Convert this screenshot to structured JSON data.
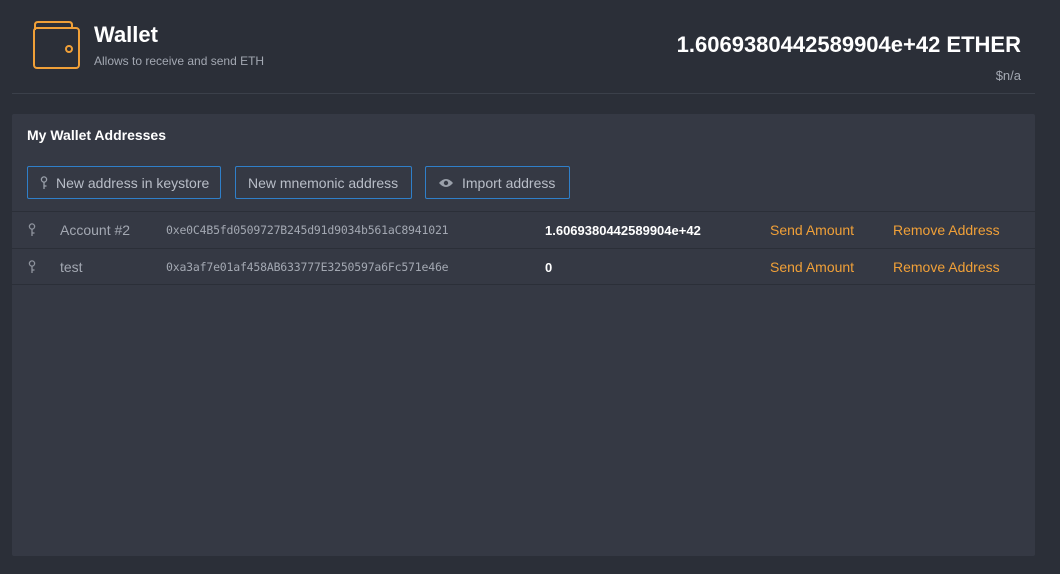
{
  "header": {
    "title": "Wallet",
    "subtitle": "Allows to receive and send ETH",
    "balance": "1.6069380442589904e+42 ETHER",
    "fiat": "$n/a",
    "icon": "wallet-icon",
    "accent_color": "#f0a038"
  },
  "panel": {
    "title": "My Wallet Addresses",
    "buttons": [
      {
        "label": "New address in keystore",
        "icon": "key-icon"
      },
      {
        "label": "New mnemonic address",
        "icon": ""
      },
      {
        "label": "Import address",
        "icon": "eye-icon"
      }
    ],
    "accounts": [
      {
        "name": "Account #2",
        "address": "0xe0C4B5fd0509727B245d91d9034b561aC8941021",
        "balance": "1.6069380442589904e+42",
        "send_label": "Send Amount",
        "remove_label": "Remove Address"
      },
      {
        "name": "test",
        "address": "0xa3af7e01af458AB633777E3250597a6Fc571e46e",
        "balance": "0",
        "send_label": "Send Amount",
        "remove_label": "Remove Address"
      }
    ]
  }
}
